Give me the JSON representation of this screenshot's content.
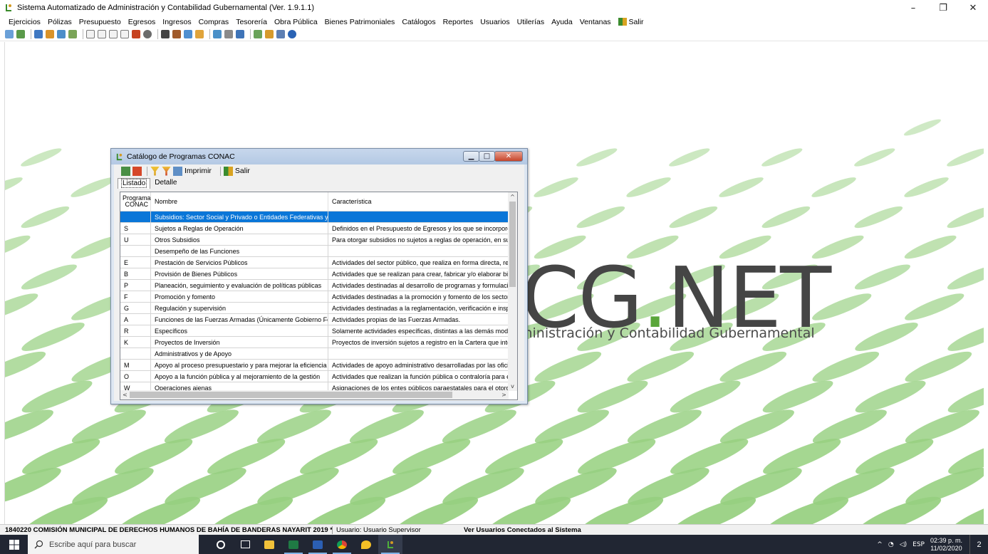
{
  "app": {
    "title": "Sistema Automatizado de Administración y Contabilidad Gubernamental (Ver. 1.9.1.1)",
    "minimize": "–",
    "maximize": "❐",
    "close": "✕"
  },
  "menu": [
    "Ejercicios",
    "Pólizas",
    "Presupuesto",
    "Egresos",
    "Ingresos",
    "Compras",
    "Tesorería",
    "Obra Pública",
    "Bienes Patrimoniales",
    "Catálogos",
    "Reportes",
    "Usuarios",
    "Utilerías",
    "Ayuda",
    "Ventanas",
    "Salir"
  ],
  "logo": {
    "text": "CG.NET",
    "subtitle": "ministración y Contabilidad Gubernamental",
    "accent_color": "#5aa63a"
  },
  "dialog": {
    "title": "Catálogo de Programas CONAC",
    "toolbar": {
      "print_label": "Imprimir",
      "exit_label": "Salir"
    },
    "tabs": [
      "Listado",
      "Detalle"
    ],
    "columns": [
      "Programa CONAC",
      "Nombre",
      "Característica"
    ],
    "rows": [
      {
        "code": "",
        "name": "Subsidios: Sector Social y Privado o Entidades Federativas y Municipios",
        "desc": "",
        "selected": true
      },
      {
        "code": "S",
        "name": "Sujetos a Reglas de Operación",
        "desc": "Definidos en el Presupuesto de Egresos y los que se incorporen en el ejer"
      },
      {
        "code": "U",
        "name": "Otros Subsidios",
        "desc": "Para otorgar subsidios no sujetos a reglas de operación, en su caso, se o"
      },
      {
        "code": "",
        "name": "Desempeño de las Funciones",
        "desc": ""
      },
      {
        "code": "E",
        "name": "Prestación de Servicios Públicos",
        "desc": "Actividades del sector público, que realiza en forma directa, regular y con"
      },
      {
        "code": "B",
        "name": "Provisión de Bienes Públicos",
        "desc": "Actividades que se realizan para crear, fabricar y/o elaborar bienes que s"
      },
      {
        "code": "P",
        "name": "Planeación, seguimiento y evaluación de políticas públicas",
        "desc": "Actividades destinadas al desarrollo de programas y formulación, diseño, e"
      },
      {
        "code": "F",
        "name": "Promoción y fomento",
        "desc": "Actividades destinadas a la promoción y fomento de los sectores social y"
      },
      {
        "code": "G",
        "name": "Regulación y supervisión",
        "desc": "Actividades destinadas a la reglamentación, verificación e inspección de"
      },
      {
        "code": "A",
        "name": "Funciones de las Fuerzas Armadas (Únicamente Gobierno Federal)",
        "desc": "Actividades propias de las Fuerzas Armadas."
      },
      {
        "code": "R",
        "name": "Específicos",
        "desc": "Solamente actividades específicas, distintas a las demás modalidades."
      },
      {
        "code": "K",
        "name": "Proyectos de Inversión",
        "desc": "Proyectos de inversión sujetos a registro en la Cartera que integra y admir"
      },
      {
        "code": "",
        "name": "Administrativos y de Apoyo",
        "desc": ""
      },
      {
        "code": "M",
        "name": "Apoyo al proceso presupuestario y para mejorar la eficiencia institucional",
        "desc": "Actividades de apoyo administrativo desarrolladas por las oficialías mayor"
      },
      {
        "code": "O",
        "name": "Apoyo a la función pública y al mejoramiento de la gestión",
        "desc": "Actividades que realizan la función pública o contraloría para el mejoramie"
      },
      {
        "code": "W",
        "name": "Operaciones ajenas",
        "desc": "Asignaciones de los entes públicos paraestatales para el otorgamiento de"
      }
    ]
  },
  "status": {
    "company": "1840220 COMISIÓN MUNICIPAL DE DERECHOS HUMANOS DE BAHÍA DE BANDERAS NAYARIT  2019  *",
    "user": "Usuario: Usuario Supervisor",
    "connected": "Ver Usuarios Conectados al Sistema"
  },
  "taskbar": {
    "search_placeholder": "Escribe aquí para buscar",
    "language": "ESP",
    "time": "02:39 p. m.",
    "date": "11/02/2020",
    "notifications": "2"
  }
}
